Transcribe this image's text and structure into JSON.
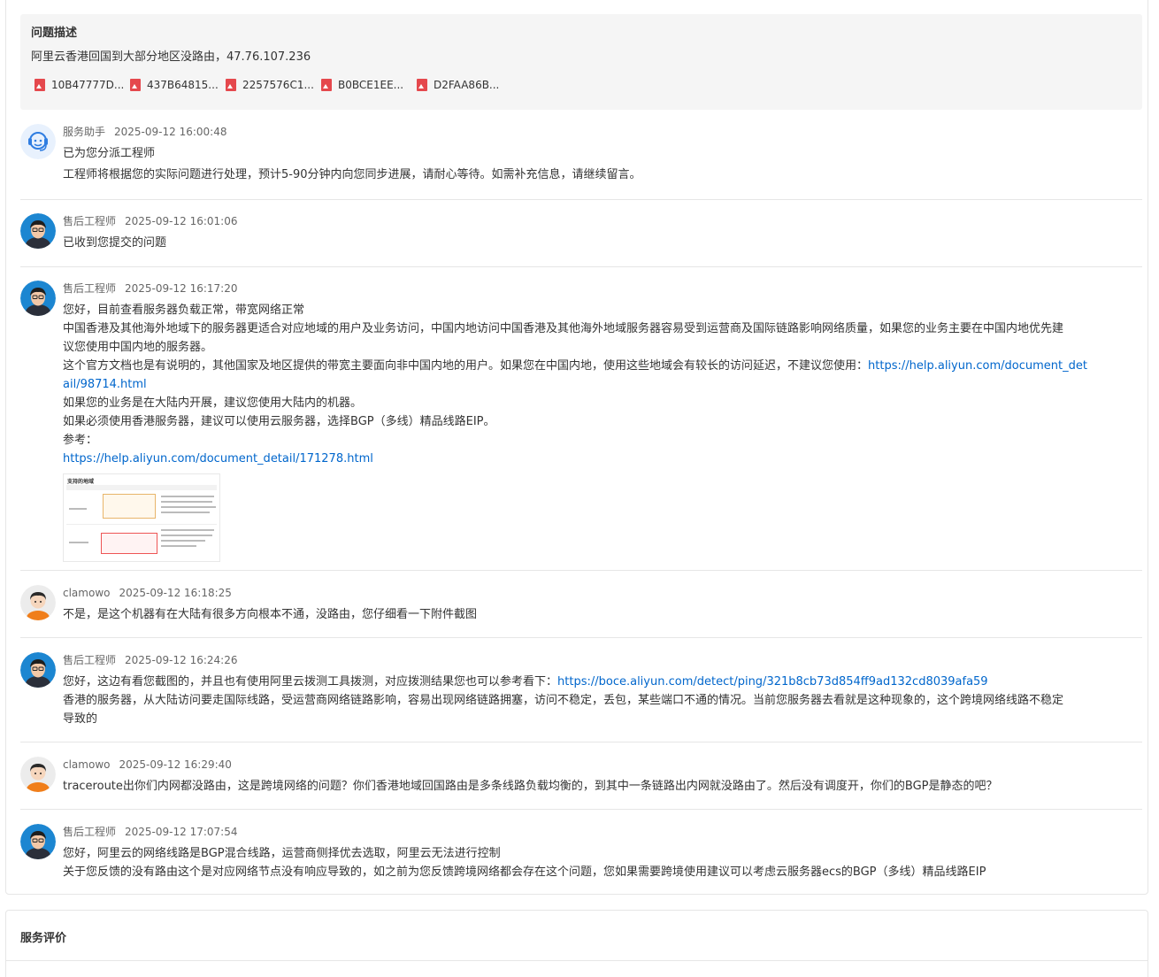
{
  "problem": {
    "title": "问题描述",
    "description": "阿里云香港回国到大部分地区没路由，47.76.107.236",
    "attachments": [
      "10B47777D...",
      "437B64815...",
      "2257576C1...",
      "B0BCE1EE...",
      "D2FAA86B..."
    ]
  },
  "messages": [
    {
      "author": "服务助手",
      "time": "2025-09-12 16:00:48",
      "lines": [
        "已为您分派工程师",
        "工程师将根据您的实际问题进行处理，预计5-90分钟内向您同步进展，请耐心等待。如需补充信息，请继续留言。"
      ]
    },
    {
      "author": "售后工程师",
      "time": "2025-09-12 16:01:06",
      "lines": [
        "已收到您提交的问题"
      ]
    },
    {
      "author": "售后工程师",
      "time": "2025-09-12 16:17:20",
      "lines": [
        "您好，目前查看服务器负载正常，带宽网络正常",
        "中国香港及其他海外地域下的服务器更适合对应地域的用户及业务访问，中国内地访问中国香港及其他海外地域服务器容易受到运营商及国际链路影响网络质量，如果您的业务主要在中国内地优先建",
        "议您使用中国内地的服务器。",
        "这个官方文档也是有说明的，其他国家及地区提供的带宽主要面向非中国内地的用户。如果您在中国内地，使用这些地域会有较长的访问延迟，不建议您使用：",
        "如果您的业务是在大陆内开展，建议您使用大陆内的机器。",
        "如果必须使用香港服务器，建议可以使用云服务器，选择BGP（多线）精品线路EIP。",
        "参考："
      ],
      "link1a": "https://help.aliyun.com/document_det",
      "link1b": "ail/98714.html",
      "link2": "https://help.aliyun.com/document_detail/171278.html",
      "thumb_title": "支持的地域"
    },
    {
      "author": "clamowo",
      "time": "2025-09-12 16:18:25",
      "lines": [
        "不是，是这个机器有在大陆有很多方向根本不通，没路由，您仔细看一下附件截图"
      ]
    },
    {
      "author": "售后工程师",
      "time": "2025-09-12 16:24:26",
      "lines": [
        "您好，这边有看您截图的，并且也有使用阿里云拨测工具拨测，对应拨测结果您也可以参考看下：",
        "香港的服务器，从大陆访问要走国际线路，受运营商网络链路影响，容易出现网络链路拥塞，访问不稳定，丢包，某些端口不通的情况。当前您服务器去看就是这种现象的，这个跨境网络线路不稳定",
        "导致的"
      ],
      "link": "https://boce.aliyun.com/detect/ping/321b8cb73d854ff9ad132cd8039afa59"
    },
    {
      "author": "clamowo",
      "time": "2025-09-12 16:29:40",
      "lines": [
        "traceroute出你们内网都没路由，这是跨境网络的问题？你们香港地域回国路由是多条线路负载均衡的，到其中一条链路出内网就没路由了。然后没有调度开，你们的BGP是静态的吧？"
      ]
    },
    {
      "author": "售后工程师",
      "time": "2025-09-12 17:07:54",
      "lines": [
        "您好，阿里云的网络线路是BGP混合线路，运营商侧择优去选取，阿里云无法进行控制",
        "关于您反馈的没有路由这个是对应网络节点没有响应导致的，如之前为您反馈跨境网络都会存在这个问题，您如果需要跨境使用建议可以考虑云服务器ecs的BGP（多线）精品线路EIP"
      ]
    }
  ],
  "rating": {
    "title": "服务评价"
  },
  "colors": {
    "link": "#0066cc",
    "pdf_icon": "#e5484d",
    "panel_bg": "#f5f5f5"
  }
}
